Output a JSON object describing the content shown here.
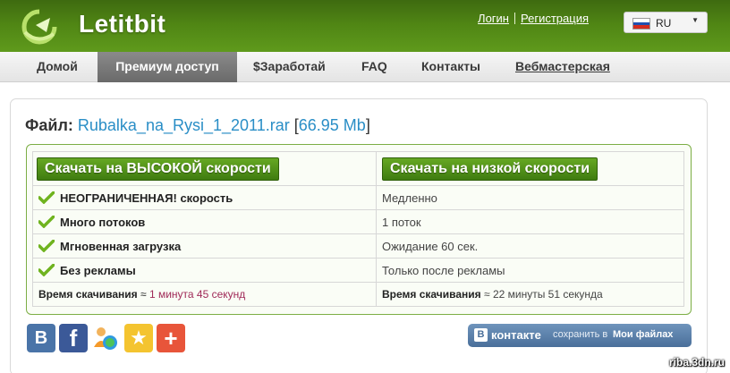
{
  "header": {
    "logo_text": "Letitbit",
    "login": "Логин",
    "register": "Регистрация",
    "language": "RU"
  },
  "nav": {
    "items": [
      "Домой",
      "Премиум доступ",
      "$Заработай",
      "FAQ",
      "Контакты",
      "Вебмастерская"
    ],
    "active": "Премиум доступ"
  },
  "file": {
    "label": "Файл:",
    "name": "Rubalka_na_Rysi_1_2011.rar",
    "size": "66.95 Mb"
  },
  "compare": {
    "fast_button": "Скачать на ВЫСОКОЙ скорости",
    "slow_button": "Скачать на низкой скорости",
    "rows": [
      {
        "fast": "НЕОГРАНИЧЕННАЯ! скорость",
        "slow": "Медленно"
      },
      {
        "fast": "Много потоков",
        "slow": "1 поток"
      },
      {
        "fast": "Мгновенная загрузка",
        "slow": "Ожидание 60 сек."
      },
      {
        "fast": "Без рекламы",
        "slow": "Только после рекламы"
      }
    ],
    "time_label": "Время скачивания",
    "approx": "≈",
    "fast_time": "1 минута 45 секунд",
    "slow_time": "22 минуты 51 секунда"
  },
  "social": {
    "vk_letter": "В",
    "fb_letter": "f",
    "star": "★",
    "plus": "+"
  },
  "vk_save": {
    "icon_letter": "В",
    "brand": "контакте",
    "middle": "сохранить в",
    "target": "Мои файлах"
  },
  "watermark": "riba.3dn.ru",
  "colors": {
    "header_green": "#4f8514",
    "link_blue": "#2a8ec6",
    "button_green": "#4f8f18",
    "fast_time": "#a02a58"
  }
}
